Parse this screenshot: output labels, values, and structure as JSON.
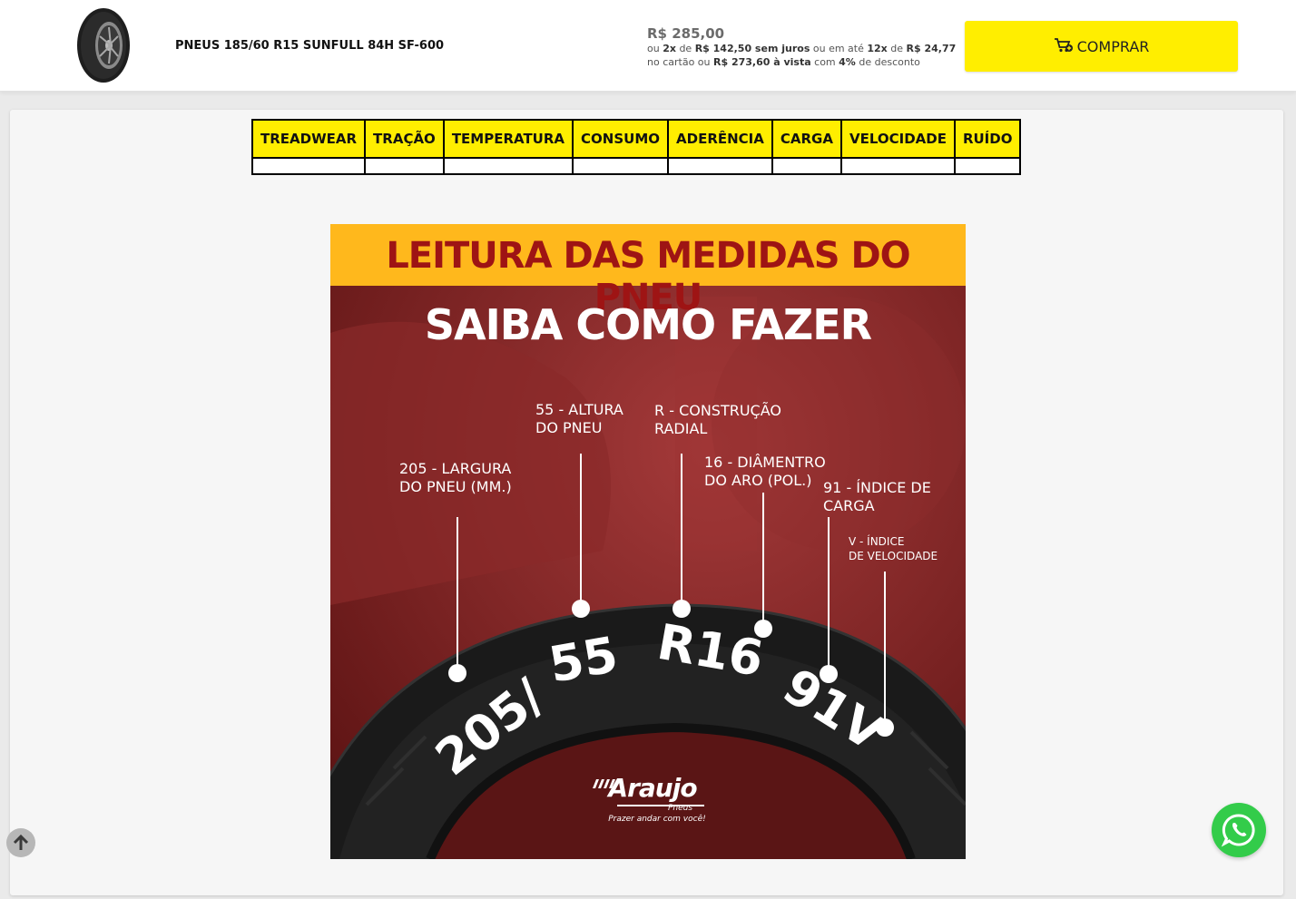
{
  "product": {
    "name": "PNEUS 185/60 R15 SUNFULL 84H SF-600",
    "image_icon": "tire-product-icon"
  },
  "pricing": {
    "main": "R$ 285,00",
    "line1": {
      "p1": "ou ",
      "b1": "2x",
      "p2": " de ",
      "b2": "R$ 142,50 sem juros",
      "p3": " ou em até ",
      "b3": "12x",
      "p4": " de ",
      "b4": "R$ 24,77"
    },
    "line2": {
      "p1": "no cartão ou ",
      "b1": "R$ 273,60 à vista",
      "p2": " com ",
      "b2": "4%",
      "p3": " de desconto"
    }
  },
  "buy_button": {
    "label": "COMPRAR",
    "icon": "cart-add-icon",
    "color": "#ffee00"
  },
  "ratings_table": {
    "headers": [
      "TREADWEAR",
      "TRAÇÃO",
      "TEMPERATURA",
      "CONSUMO",
      "ADERÊNCIA",
      "CARGA",
      "VELOCIDADE",
      "RUÍDO"
    ],
    "values": [
      "",
      "",
      "",
      "",
      "",
      "",
      "",
      ""
    ]
  },
  "banner": {
    "title": "LEITURA DAS MEDIDAS DO PNEU",
    "subtitle": "SAIBA COMO FAZER",
    "labels": {
      "width": [
        "205 - LARGURA",
        "DO PNEU (MM.)"
      ],
      "height": [
        "55 - ALTURA",
        "DO PNEU"
      ],
      "construction": [
        "R - CONSTRUÇÃO",
        "RADIAL"
      ],
      "diameter": [
        "16 - DIÂMENTRO",
        "DO ARO (POL.)"
      ],
      "load": [
        "91 - ÍNDICE DE",
        "CARGA"
      ],
      "speed": [
        "V - ÍNDICE",
        "DE VELOCIDADE"
      ]
    },
    "tire_text": "205/55 R16 91V",
    "brand": {
      "name": "Araujo",
      "sub": "Pneus",
      "tagline": "Prazer andar com você!"
    },
    "colors": {
      "header": "#ffb81c",
      "title": "#9e1414",
      "background": "#7a1c1c"
    }
  },
  "floating": {
    "scroll_top_icon": "arrow-up-icon",
    "whatsapp_icon": "whatsapp-icon",
    "whatsapp_color": "#33cc4a"
  }
}
